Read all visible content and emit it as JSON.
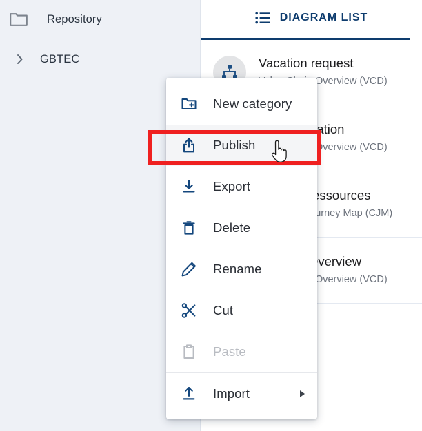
{
  "sidebar": {
    "items": [
      {
        "label": "Repository",
        "icon": "folder-icon"
      },
      {
        "label": "GBTEC",
        "icon": "chevron-right-icon"
      }
    ]
  },
  "panel": {
    "tab": {
      "label": "DIAGRAM LIST",
      "icon": "list-icon",
      "active": true
    },
    "accent_color": "#0e3c6e",
    "diagrams": [
      {
        "title": "Vacation request",
        "subtitle": "Value Chain Overview (VCD)",
        "icon": "hierarchy-icon"
      },
      {
        "title": "Documentation",
        "subtitle": "Value Chain Overview (VCD)",
        "icon": "hierarchy-icon"
      },
      {
        "title": "Human Ressources",
        "subtitle": "Customer Journey Map (CJM)",
        "icon": "hierarchy-icon"
      },
      {
        "title": "Process Overview",
        "subtitle": "Value Chain Overview (VCD)",
        "icon": "hierarchy-icon"
      }
    ]
  },
  "context_menu": {
    "items": [
      {
        "label": "New category",
        "icon": "folder-plus-icon",
        "state": "normal",
        "submenu": false,
        "separator_above": false
      },
      {
        "label": "Publish",
        "icon": "publish-upload-icon",
        "state": "highlighted",
        "submenu": false,
        "separator_above": false
      },
      {
        "label": "Export",
        "icon": "download-icon",
        "state": "normal",
        "submenu": false,
        "separator_above": false
      },
      {
        "label": "Delete",
        "icon": "trash-icon",
        "state": "normal",
        "submenu": false,
        "separator_above": false
      },
      {
        "label": "Rename",
        "icon": "pencil-icon",
        "state": "normal",
        "submenu": false,
        "separator_above": false
      },
      {
        "label": "Cut",
        "icon": "scissors-icon",
        "state": "normal",
        "submenu": false,
        "separator_above": false
      },
      {
        "label": "Paste",
        "icon": "clipboard-icon",
        "state": "disabled",
        "submenu": false,
        "separator_above": false
      },
      {
        "label": "Import",
        "icon": "import-upload-icon",
        "state": "normal",
        "submenu": true,
        "separator_above": true
      }
    ]
  },
  "annotation": {
    "highlight_target": "Publish",
    "highlight_color": "#ef2020"
  },
  "cursor": {
    "type": "pointer-hand-cursor"
  }
}
